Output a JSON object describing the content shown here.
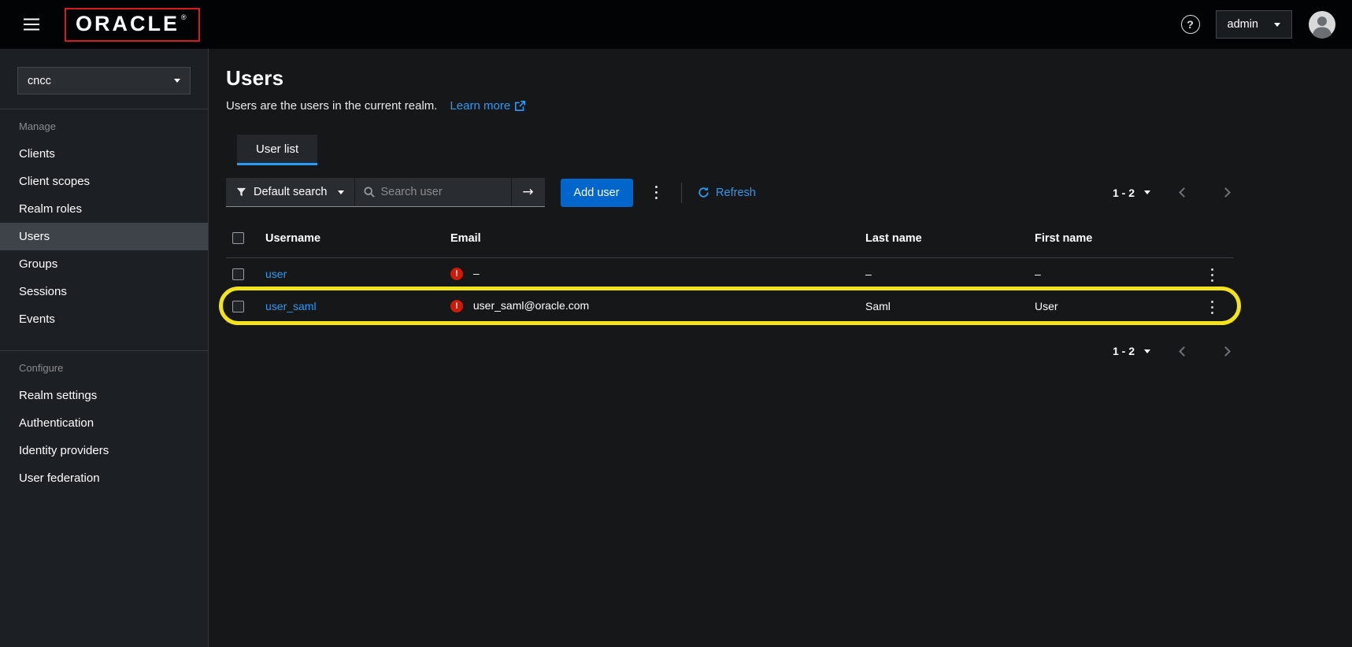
{
  "colors": {
    "accent_blue": "#2b9af3",
    "primary_button_blue": "#0066cc",
    "danger_red": "#cc1b0b",
    "highlight_yellow": "#f2e31d",
    "topbar_black": "#020304",
    "sidebar_bg": "#1c1f23"
  },
  "topbar": {
    "brand": "ORACLE",
    "brand_mark": "®",
    "help_label": "?",
    "user_menu_label": "admin"
  },
  "sidebar": {
    "realm_select_value": "cncc",
    "manage_label": "Manage",
    "configure_label": "Configure",
    "manage_items": [
      "Clients",
      "Client scopes",
      "Realm roles",
      "Users",
      "Groups",
      "Sessions",
      "Events"
    ],
    "configure_items": [
      "Realm settings",
      "Authentication",
      "Identity providers",
      "User federation"
    ],
    "selected_item": "Users"
  },
  "main": {
    "title": "Users",
    "subtitle": "Users are the users in the current realm.",
    "learn_more_label": "Learn more",
    "tab_user_list": "User list",
    "toolbar": {
      "filter_label": "Default search",
      "search_placeholder": "Search user",
      "arrow_label": "→",
      "add_user_label": "Add user",
      "refresh_label": "Refresh",
      "pagination_label": "1 - 2"
    },
    "table": {
      "headers": {
        "username": "Username",
        "email": "Email",
        "last_name": "Last name",
        "first_name": "First name"
      },
      "rows": [
        {
          "username": "user",
          "email": "–",
          "last_name": "–",
          "first_name": "–",
          "highlighted": false
        },
        {
          "username": "user_saml",
          "email": "user_saml@oracle.com",
          "last_name": "Saml",
          "first_name": "User",
          "highlighted": true
        }
      ]
    },
    "bottom_pagination_label": "1 - 2"
  }
}
